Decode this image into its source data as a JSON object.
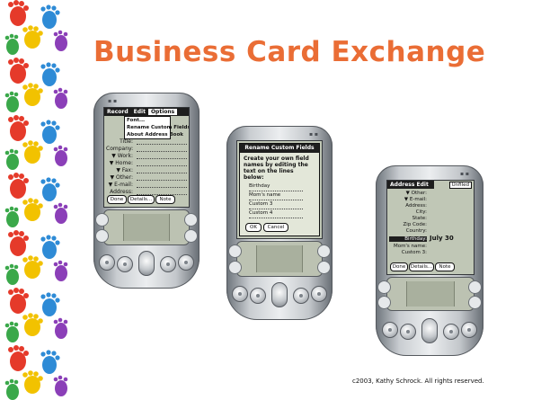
{
  "slide": {
    "title": "Business Card Exchange",
    "copyright": "c2003, Kathy Schrock. All rights reserved."
  },
  "decoration": {
    "left_border": "colorful handprints",
    "title_color": "#ea6d35"
  },
  "devices": [
    {
      "screen": "address-record-options",
      "menu": [
        "Record",
        "Edit",
        "Options"
      ],
      "menu_selected": "Options",
      "dropdown": [
        "Font...",
        "Rename Custom Fields",
        "About Address Book"
      ],
      "fields": [
        "Title:",
        "Company:",
        "▼ Work:",
        "▼ Home:",
        "▼ Fax:",
        "▼ Other:",
        "▼ E-mail:",
        "Address:"
      ],
      "buttons": [
        "Done",
        "Details...",
        "Note"
      ]
    },
    {
      "screen": "rename-custom-fields",
      "dialog_title": "Rename Custom Fields",
      "instructions": "Create your own field names by editing the text on the lines below:",
      "fields": [
        "Birthday",
        "Mom's name",
        "Custom 3",
        "Custom 4"
      ],
      "buttons": [
        "OK",
        "Cancel"
      ]
    },
    {
      "screen": "address-edit",
      "tab": "Address Edit",
      "category": "Unfiled",
      "fields": [
        "▼ Other:",
        "▼ E-mail:",
        "Address:",
        "City:",
        "State:",
        "Zip Code:",
        "Country:",
        "Birthday:",
        "Mom's name:",
        "Custom 3:"
      ],
      "highlighted_field": "Birthday:",
      "birthday_value": "July 30",
      "buttons": [
        "Done",
        "Details...",
        "Note"
      ]
    }
  ]
}
